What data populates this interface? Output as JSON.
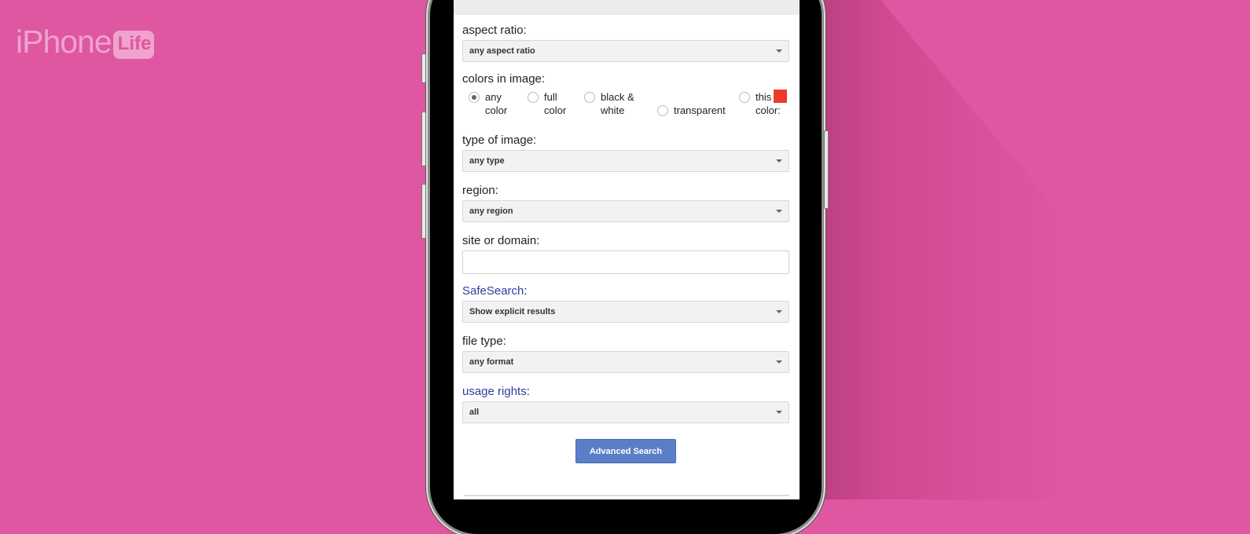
{
  "branding": {
    "logo_main": "iPhone",
    "logo_badge": "Life",
    "background_color": "#df56a1"
  },
  "form": {
    "aspect_ratio": {
      "label": "aspect ratio:",
      "value": "any aspect ratio"
    },
    "colors": {
      "label": "colors in image:",
      "options": [
        {
          "line1": "any",
          "line2": "color",
          "checked": true
        },
        {
          "line1": "full",
          "line2": "color",
          "checked": false
        },
        {
          "line1": "black &",
          "line2": "white",
          "checked": false
        },
        {
          "line1": "",
          "line2": "transparent",
          "checked": false
        },
        {
          "line1": "this",
          "line2": "color:",
          "checked": false
        }
      ],
      "swatch_color": "#ee3a2c"
    },
    "type_of_image": {
      "label": "type of image:",
      "value": "any type"
    },
    "region": {
      "label": "region:",
      "value": "any region"
    },
    "site_or_domain": {
      "label": "site or domain:",
      "value": ""
    },
    "safesearch": {
      "label": "SafeSearch",
      "colon": ":",
      "value": "Show explicit results"
    },
    "file_type": {
      "label": "file type:",
      "value": "any format"
    },
    "usage_rights": {
      "label": "usage rights",
      "colon": ":",
      "value": "all"
    },
    "submit_label": "Advanced Search",
    "accent_color": "#5a7fc8",
    "link_color": "#2d3f9c"
  }
}
